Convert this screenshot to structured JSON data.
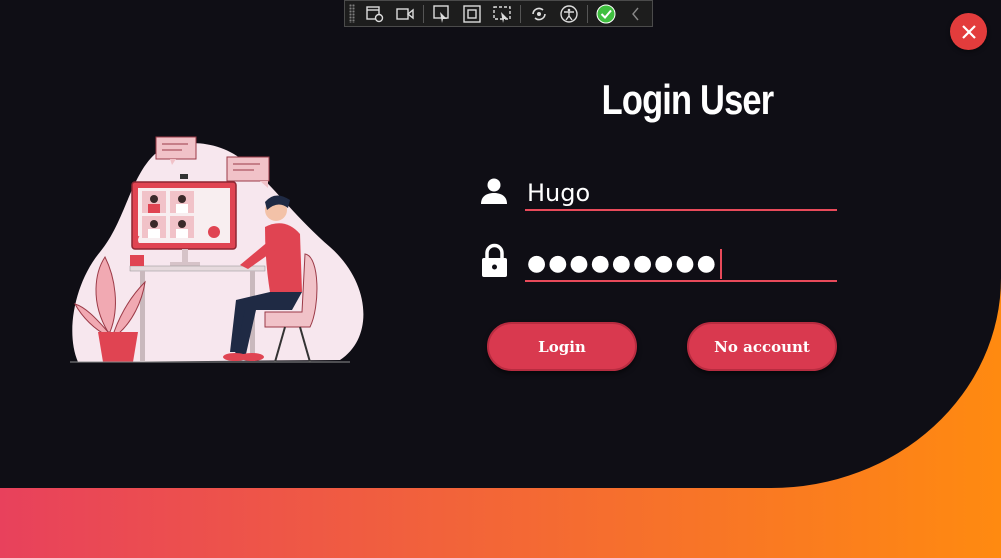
{
  "toolbar": {
    "icons": [
      "select-element-icon",
      "video-icon",
      "pointer-icon",
      "rect-icon",
      "display-layout-icon",
      "hot-reload-icon",
      "accessibility-icon",
      "check-icon",
      "chevron-left-icon"
    ]
  },
  "window": {
    "close_icon": "close-icon"
  },
  "login": {
    "title": "Login User",
    "username_value": "Hugo",
    "password_value": "●●●●●●●●●",
    "login_label": "Login",
    "no_account_label": "No account"
  },
  "colors": {
    "background": "#0f0e15",
    "accent": "#e84a5a",
    "button": "#d9394f",
    "gradient_start": "#e8415c",
    "gradient_end": "#ff8a10",
    "close": "#e33c3c"
  }
}
